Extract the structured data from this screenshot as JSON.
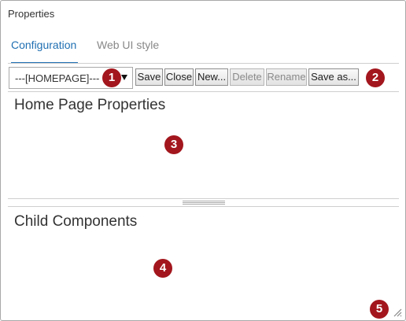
{
  "dialog": {
    "title": "Properties"
  },
  "tabs": [
    {
      "label": "Configuration",
      "active": true
    },
    {
      "label": "Web UI style",
      "active": false
    }
  ],
  "toolbar": {
    "page_select": {
      "value": "---[HOMEPAGE]---"
    },
    "buttons": [
      {
        "label": "Save",
        "enabled": true
      },
      {
        "label": "Close",
        "enabled": true
      },
      {
        "label": "New...",
        "enabled": true
      },
      {
        "label": "Delete",
        "enabled": false
      },
      {
        "label": "Rename",
        "enabled": false
      },
      {
        "label": "Save as...",
        "enabled": true
      }
    ]
  },
  "sections": {
    "properties_title": "Home Page Properties",
    "children_title": "Child Components"
  },
  "callouts": [
    "1",
    "2",
    "3",
    "4",
    "5"
  ],
  "colors": {
    "accent": "#1f6fb2",
    "callout": "#a3161d"
  }
}
